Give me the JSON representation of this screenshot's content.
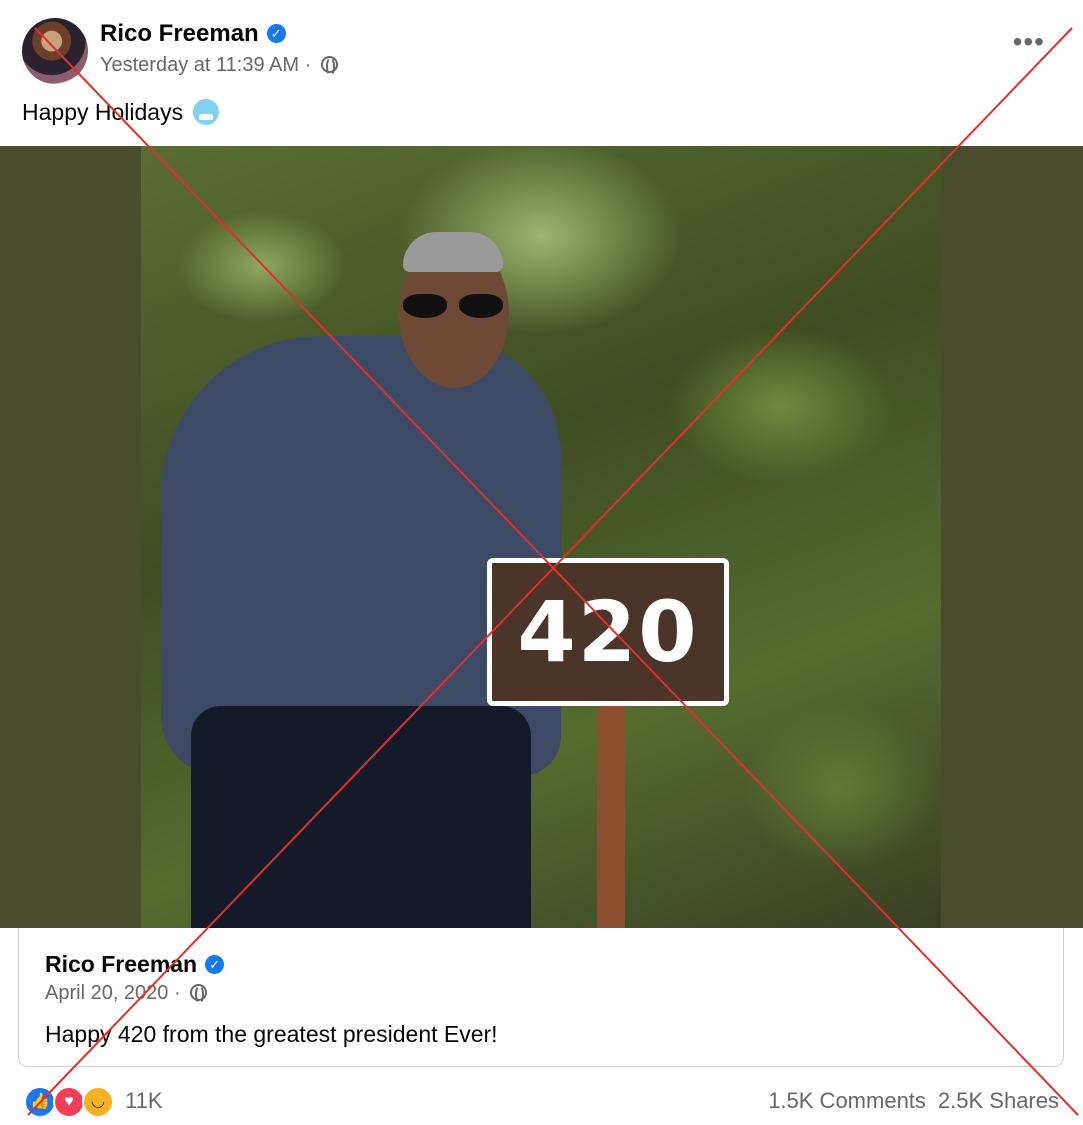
{
  "post": {
    "author": "Rico Freeman",
    "timestamp": "Yesterday at 11:39 AM",
    "separator": "·",
    "caption": "Happy Holidays",
    "more_label": "•••"
  },
  "shared_post": {
    "author": "Rico Freeman",
    "date": "April 20, 2020",
    "separator": "·",
    "text": "Happy 420 from the greatest president Ever!"
  },
  "photo": {
    "sign_text": "420"
  },
  "footer": {
    "reaction_count": "11K",
    "comments": "1.5K Comments",
    "shares": "2.5K Shares"
  },
  "icons": {
    "verified": "verified-badge-icon",
    "globe": "globe-icon",
    "emoji": "cold-face-emoji",
    "reactions": [
      "like-icon",
      "love-icon",
      "haha-icon"
    ]
  },
  "colors": {
    "facebook_blue": "#1877f2",
    "secondary_text": "#65676b",
    "cross_overlay": "#e0302e",
    "photo_background": "#4a4c2e"
  }
}
